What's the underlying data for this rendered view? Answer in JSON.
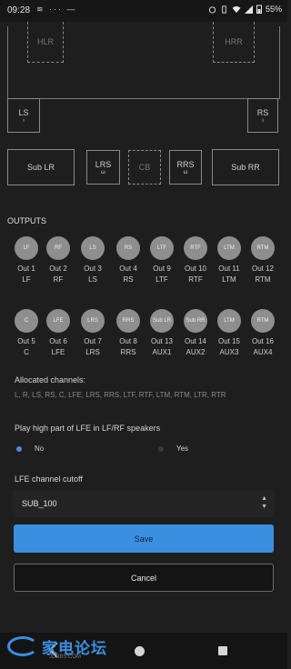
{
  "status_bar": {
    "time": "09:28",
    "left_icons": "≋ ··· —",
    "battery": "55%"
  },
  "layout": {
    "top_left": "HLR",
    "top_right": "HRR",
    "ls": {
      "label": "LS",
      "sub": "ι"
    },
    "rs": {
      "label": "RS",
      "sub": "ι"
    },
    "sub_lr": "Sub LR",
    "sub_rr": "Sub RR",
    "lrs": {
      "label": "LRS",
      "sub": "ω"
    },
    "cb": "CB",
    "rrs": {
      "label": "RRS",
      "sub": "ω"
    }
  },
  "outputs": {
    "title": "OUTPUTS",
    "channels": [
      {
        "circle": "LF",
        "out": "Out 1",
        "name": "LF"
      },
      {
        "circle": "RF",
        "out": "Out 2",
        "name": "RF"
      },
      {
        "circle": "LS",
        "out": "Out 3",
        "name": "LS"
      },
      {
        "circle": "RS",
        "out": "Out 4",
        "name": "RS"
      },
      {
        "circle": "LTF",
        "out": "Out 9",
        "name": "LTF"
      },
      {
        "circle": "RTF",
        "out": "Out 10",
        "name": "RTF"
      },
      {
        "circle": "LTM",
        "out": "Out 11",
        "name": "LTM"
      },
      {
        "circle": "RTM",
        "out": "Out 12",
        "name": "RTM"
      },
      {
        "circle": "C",
        "out": "Out 5",
        "name": "C"
      },
      {
        "circle": "LFE",
        "out": "Out 6",
        "name": "LFE"
      },
      {
        "circle": "LRS",
        "out": "Out 7",
        "name": "LRS"
      },
      {
        "circle": "RRS",
        "out": "Out 8",
        "name": "RRS"
      },
      {
        "circle": "Sub LR",
        "out": "Out 13",
        "name": "AUX1"
      },
      {
        "circle": "Sub RR",
        "out": "Out 14",
        "name": "AUX2"
      },
      {
        "circle": "LTM",
        "out": "Out 15",
        "name": "AUX3"
      },
      {
        "circle": "RTM",
        "out": "Out 16",
        "name": "AUX4"
      }
    ]
  },
  "allocated": {
    "label": "Allocated channels:",
    "value": "L, R, LS, RS, C, LFE, LRS, RRS, LTF, RTF, LTM, RTM, LTR, RTR"
  },
  "play_high": {
    "label": "Play high part of LFE in LF/RF speakers",
    "options": [
      {
        "label": "No",
        "selected": true
      },
      {
        "label": "Yes",
        "selected": false
      }
    ]
  },
  "cutoff": {
    "label": "LFE channel cutoff",
    "value": "SUB_100"
  },
  "buttons": {
    "save": "Save",
    "cancel": "Cancel"
  },
  "watermark": {
    "text": "家电论坛",
    "sub": "JDBBS.COM"
  },
  "colors": {
    "accent": "#3a8fe0",
    "background": "#1e1e1e",
    "channel_circle": "#8e8e8e"
  }
}
